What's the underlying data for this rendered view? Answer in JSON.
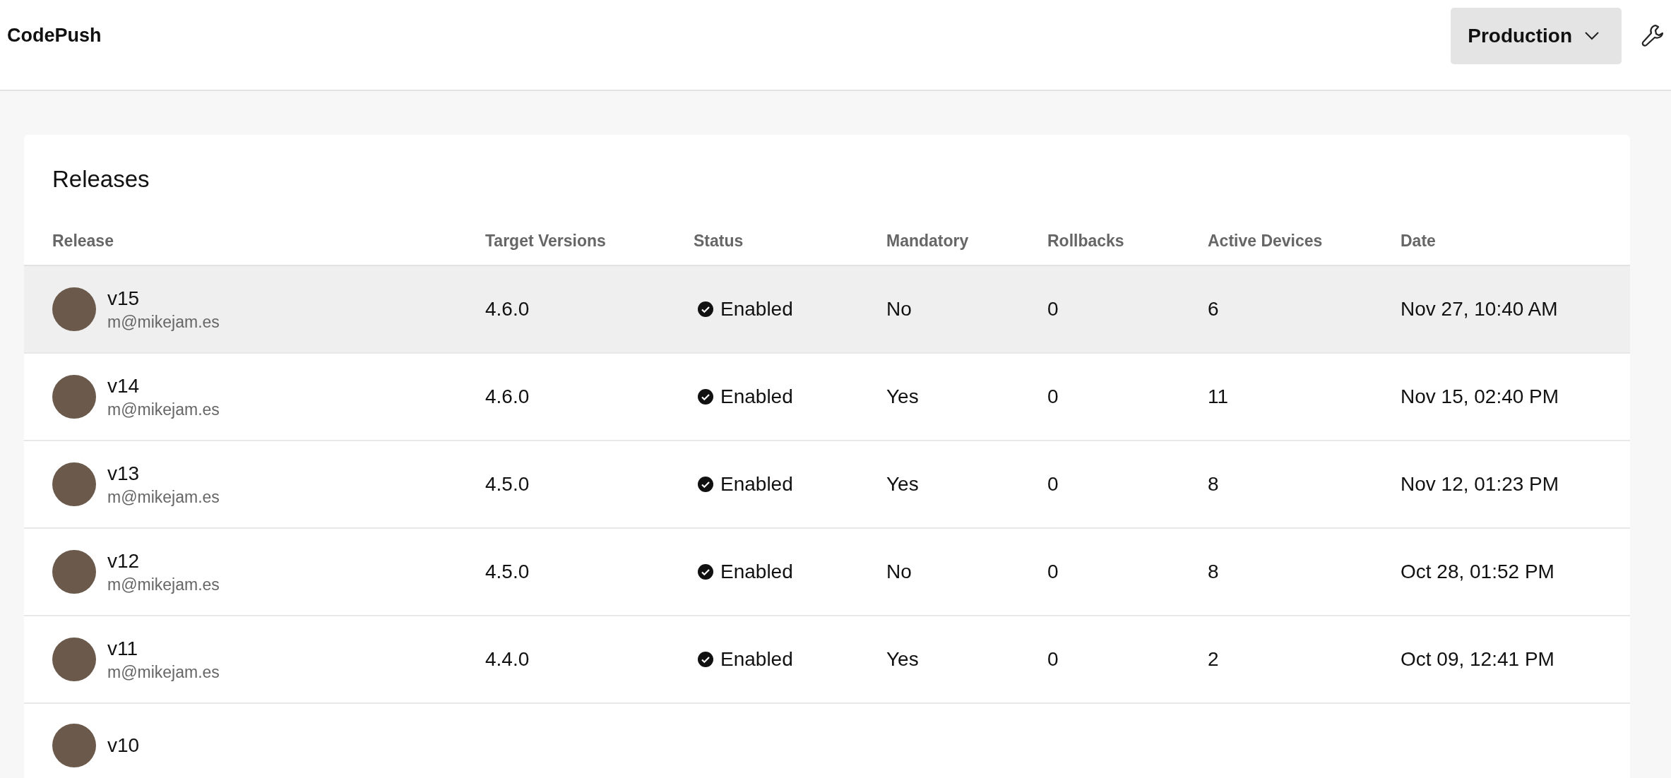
{
  "app": {
    "title": "CodePush",
    "environment": "Production"
  },
  "releases": {
    "title": "Releases",
    "columns": [
      "Release",
      "Target Versions",
      "Status",
      "Mandatory",
      "Rollbacks",
      "Active Devices",
      "Date"
    ],
    "rows": [
      {
        "label": "v15",
        "author": "m@mikejam.es",
        "target": "4.6.0",
        "status": "Enabled",
        "enabled": true,
        "mandatory": "No",
        "rollbacks": "0",
        "active_devices": "6",
        "date": "Nov 27, 10:40 AM",
        "selected": true
      },
      {
        "label": "v14",
        "author": "m@mikejam.es",
        "target": "4.6.0",
        "status": "Enabled",
        "enabled": true,
        "mandatory": "Yes",
        "rollbacks": "0",
        "active_devices": "11",
        "date": "Nov 15, 02:40 PM",
        "selected": false
      },
      {
        "label": "v13",
        "author": "m@mikejam.es",
        "target": "4.5.0",
        "status": "Enabled",
        "enabled": true,
        "mandatory": "Yes",
        "rollbacks": "0",
        "active_devices": "8",
        "date": "Nov 12, 01:23 PM",
        "selected": false
      },
      {
        "label": "v12",
        "author": "m@mikejam.es",
        "target": "4.5.0",
        "status": "Enabled",
        "enabled": true,
        "mandatory": "No",
        "rollbacks": "0",
        "active_devices": "8",
        "date": "Oct 28, 01:52 PM",
        "selected": false
      },
      {
        "label": "v11",
        "author": "m@mikejam.es",
        "target": "4.4.0",
        "status": "Enabled",
        "enabled": true,
        "mandatory": "Yes",
        "rollbacks": "0",
        "active_devices": "2",
        "date": "Oct 09, 12:41 PM",
        "selected": false
      },
      {
        "label": "v10",
        "selected": false
      }
    ]
  }
}
